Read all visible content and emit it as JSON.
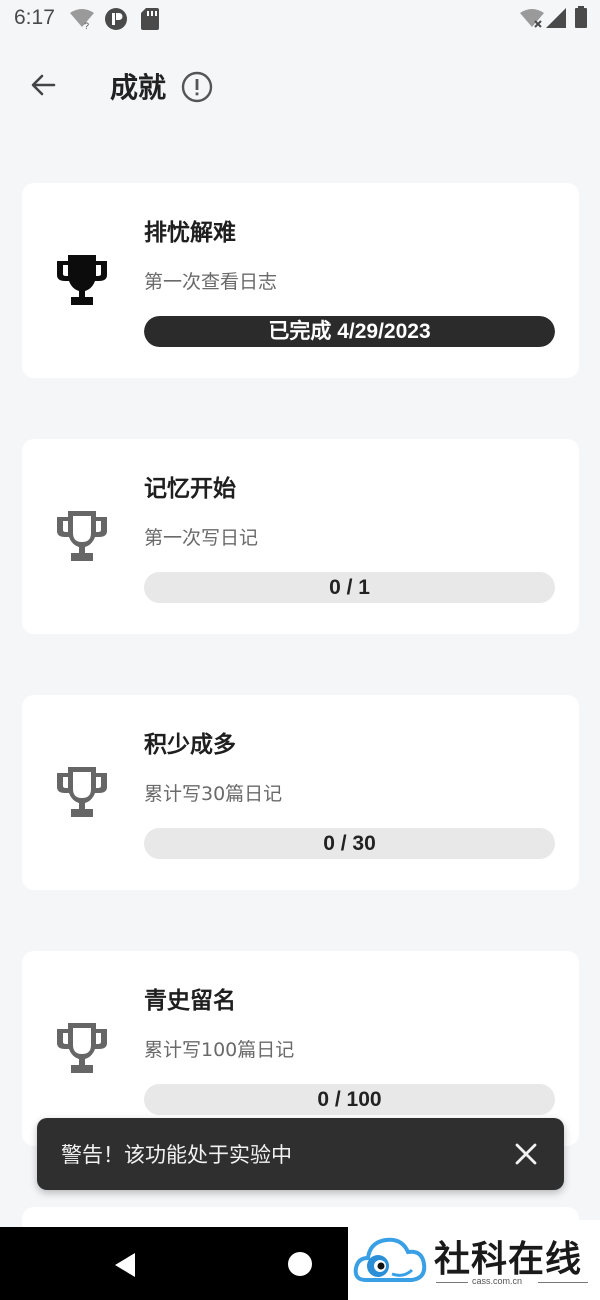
{
  "status_bar": {
    "time": "6:17",
    "icons": [
      "wifi-question-icon",
      "notification-p-icon",
      "sd-card-icon",
      "wifi-off-icon",
      "signal-icon",
      "battery-icon"
    ]
  },
  "header": {
    "title": "成就",
    "back_icon": "arrow-left-icon",
    "info_icon": "info-circle-icon"
  },
  "achievements": [
    {
      "title": "排忧解难",
      "description": "第一次查看日志",
      "progress_text": "已完成 4/29/2023",
      "progress": 1,
      "completed": true,
      "icon": "trophy-filled-icon"
    },
    {
      "title": "记忆开始",
      "description": "第一次写日记",
      "progress_text": "0 / 1",
      "progress": 0,
      "completed": false,
      "icon": "trophy-outline-icon"
    },
    {
      "title": "积少成多",
      "description": "累计写30篇日记",
      "progress_text": "0 / 30",
      "progress": 0,
      "completed": false,
      "icon": "trophy-outline-icon"
    },
    {
      "title": "青史留名",
      "description": "累计写100篇日记",
      "progress_text": "0 / 100",
      "progress": 0,
      "completed": false,
      "icon": "trophy-outline-icon"
    }
  ],
  "snackbar": {
    "message": "警告！该功能处于实验中",
    "close_icon": "close-icon"
  },
  "nav_bar": {
    "back_icon": "nav-back-triangle-icon",
    "home_icon": "nav-home-circle-icon"
  },
  "watermark": {
    "text": "社科在线",
    "sub": "cass.com.cn"
  },
  "colors": {
    "background": "#f5f6f8",
    "card": "#ffffff",
    "progress_track": "#e8e8e8",
    "progress_fill": "#2b2b2b",
    "snackbar": "#2f2f2f",
    "watermark_blue": "#3aa0e6"
  }
}
